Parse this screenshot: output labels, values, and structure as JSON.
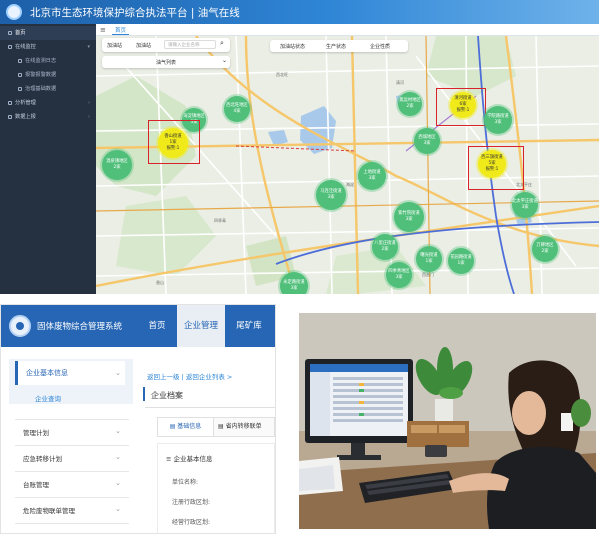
{
  "platform": {
    "title": "北京市生态环境保护综合执法平台 | 油气在线",
    "home_tab": "首页",
    "sidebar": [
      {
        "label": "首页",
        "icon": "home-icon"
      },
      {
        "label": "在线监控",
        "icon": "monitor-icon"
      },
      {
        "label": "在线监测日志",
        "icon": "log-icon"
      },
      {
        "label": "报警报警数据",
        "icon": "alarm-icon"
      },
      {
        "label": "治理基础数据",
        "icon": "data-icon"
      },
      {
        "label": "分析管理",
        "icon": "analysis-icon"
      },
      {
        "label": "数据上报",
        "icon": "upload-icon"
      }
    ],
    "map_controls": {
      "btn1": "加油站",
      "btn2": "加油站",
      "search_placeholder": "请输入企业名称",
      "list_label": "油气列表",
      "btn3": "加油站状态",
      "btn4": "生产状态",
      "btn5": "企业性质"
    },
    "clusters": [
      {
        "name": "西北旺地区",
        "count": "4家",
        "color": "green"
      },
      {
        "name": "海淀镇地区",
        "count": "3家",
        "color": "green"
      },
      {
        "name": "香山街道",
        "count": "1家",
        "color": "yellow",
        "alarm": "报警:1"
      },
      {
        "name": "温泉镇地区",
        "count": "2家",
        "color": "green"
      },
      {
        "name": "奥运村地区",
        "count": "2家",
        "color": "green"
      },
      {
        "name": "清河街道",
        "count": "6家",
        "color": "yellow",
        "alarm": "报警:1"
      },
      {
        "name": "学院路街道",
        "count": "3家",
        "color": "green"
      },
      {
        "name": "西三旗街道",
        "count": "5家",
        "color": "yellow",
        "alarm": "报警:1"
      },
      {
        "name": "西城地区",
        "count": "3家",
        "color": "green"
      },
      {
        "name": "上地街道",
        "count": "3家",
        "color": "green"
      },
      {
        "name": "马连洼街道",
        "count": "3家",
        "color": "green"
      },
      {
        "name": "北太平庄街道",
        "count": "3家",
        "color": "green"
      },
      {
        "name": "紫竹院街道",
        "count": "3家",
        "color": "green"
      },
      {
        "name": "八里庄街道",
        "count": "2家",
        "color": "green"
      },
      {
        "name": "曙光街道",
        "count": "1家",
        "color": "green"
      },
      {
        "name": "花园路街道",
        "count": "1家",
        "color": "green"
      },
      {
        "name": "四季青地区",
        "count": "3家",
        "color": "green"
      },
      {
        "name": "万柳地区",
        "count": "2家",
        "color": "green"
      },
      {
        "name": "永定路街道",
        "count": "3家",
        "color": "green"
      },
      {
        "name": "北下关街道",
        "count": "1家",
        "color": "green"
      },
      {
        "name": "田村路街道",
        "count": "4家",
        "color": "green"
      }
    ]
  },
  "waste": {
    "title": "固体废物综合管理系统",
    "nav": [
      "首页",
      "企业管理",
      "尾矿库"
    ],
    "menu_group": "企业基本信息",
    "menu_sub": "企业查询",
    "menu_items": [
      "管理计划",
      "应急转移计划",
      "台账管理",
      "危险废物联单管理"
    ],
    "breadcrumb": "返回上一级 | 返回企业列表 >",
    "archive_title": "企业档案",
    "tab_basic": "基础信息",
    "tab_transfer": "省内转移联单",
    "section_title": "企业基本信息",
    "fields": [
      "单位名称:",
      "注册行政区划:",
      "经营行政区划:"
    ]
  },
  "colors": {
    "brand_blue": "#2666b4",
    "cluster_green": "#4fbf7a",
    "cluster_yellow": "#f1ea1a",
    "alarm_red": "#d8232a"
  }
}
